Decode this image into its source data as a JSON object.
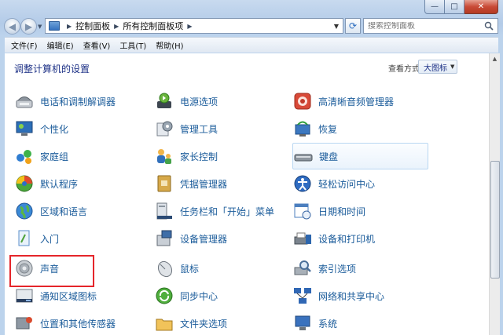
{
  "nav": {
    "breadcrumbs": [
      "控制面板",
      "所有控制面板项"
    ],
    "search_placeholder": "搜索控制面板"
  },
  "menu": [
    "文件(F)",
    "编辑(E)",
    "查看(V)",
    "工具(T)",
    "帮助(H)"
  ],
  "content": {
    "heading": "调整计算机的设置",
    "view_by_label": "查看方式:",
    "view_by_value": "大图标"
  },
  "items": [
    {
      "label": "电话和调制解调器",
      "icon": "phone-modem-icon"
    },
    {
      "label": "电源选项",
      "icon": "power-options-icon"
    },
    {
      "label": "高清晰音频管理器",
      "icon": "hd-audio-manager-icon"
    },
    {
      "label": "个性化",
      "icon": "personalization-icon"
    },
    {
      "label": "管理工具",
      "icon": "admin-tools-icon"
    },
    {
      "label": "恢复",
      "icon": "recovery-icon"
    },
    {
      "label": "家庭组",
      "icon": "homegroup-icon"
    },
    {
      "label": "家长控制",
      "icon": "parental-controls-icon"
    },
    {
      "label": "键盘",
      "icon": "keyboard-icon"
    },
    {
      "label": "默认程序",
      "icon": "default-programs-icon"
    },
    {
      "label": "凭据管理器",
      "icon": "credential-manager-icon"
    },
    {
      "label": "轻松访问中心",
      "icon": "ease-of-access-icon"
    },
    {
      "label": "区域和语言",
      "icon": "region-language-icon"
    },
    {
      "label": "任务栏和「开始」菜单",
      "icon": "taskbar-start-menu-icon"
    },
    {
      "label": "日期和时间",
      "icon": "date-time-icon"
    },
    {
      "label": "入门",
      "icon": "getting-started-icon"
    },
    {
      "label": "设备管理器",
      "icon": "device-manager-icon"
    },
    {
      "label": "设备和打印机",
      "icon": "devices-printers-icon"
    },
    {
      "label": "声音",
      "icon": "sound-icon"
    },
    {
      "label": "鼠标",
      "icon": "mouse-icon"
    },
    {
      "label": "索引选项",
      "icon": "indexing-options-icon"
    },
    {
      "label": "通知区域图标",
      "icon": "notification-area-icons-icon"
    },
    {
      "label": "同步中心",
      "icon": "sync-center-icon"
    },
    {
      "label": "网络和共享中心",
      "icon": "network-sharing-icon"
    },
    {
      "label": "位置和其他传感器",
      "icon": "location-sensors-icon"
    },
    {
      "label": "文件夹选项",
      "icon": "folder-options-icon"
    },
    {
      "label": "系统",
      "icon": "system-icon"
    }
  ],
  "colors": {
    "link": "#1a5b9a",
    "heading": "#1e3287",
    "highlight": "#e5252a"
  }
}
